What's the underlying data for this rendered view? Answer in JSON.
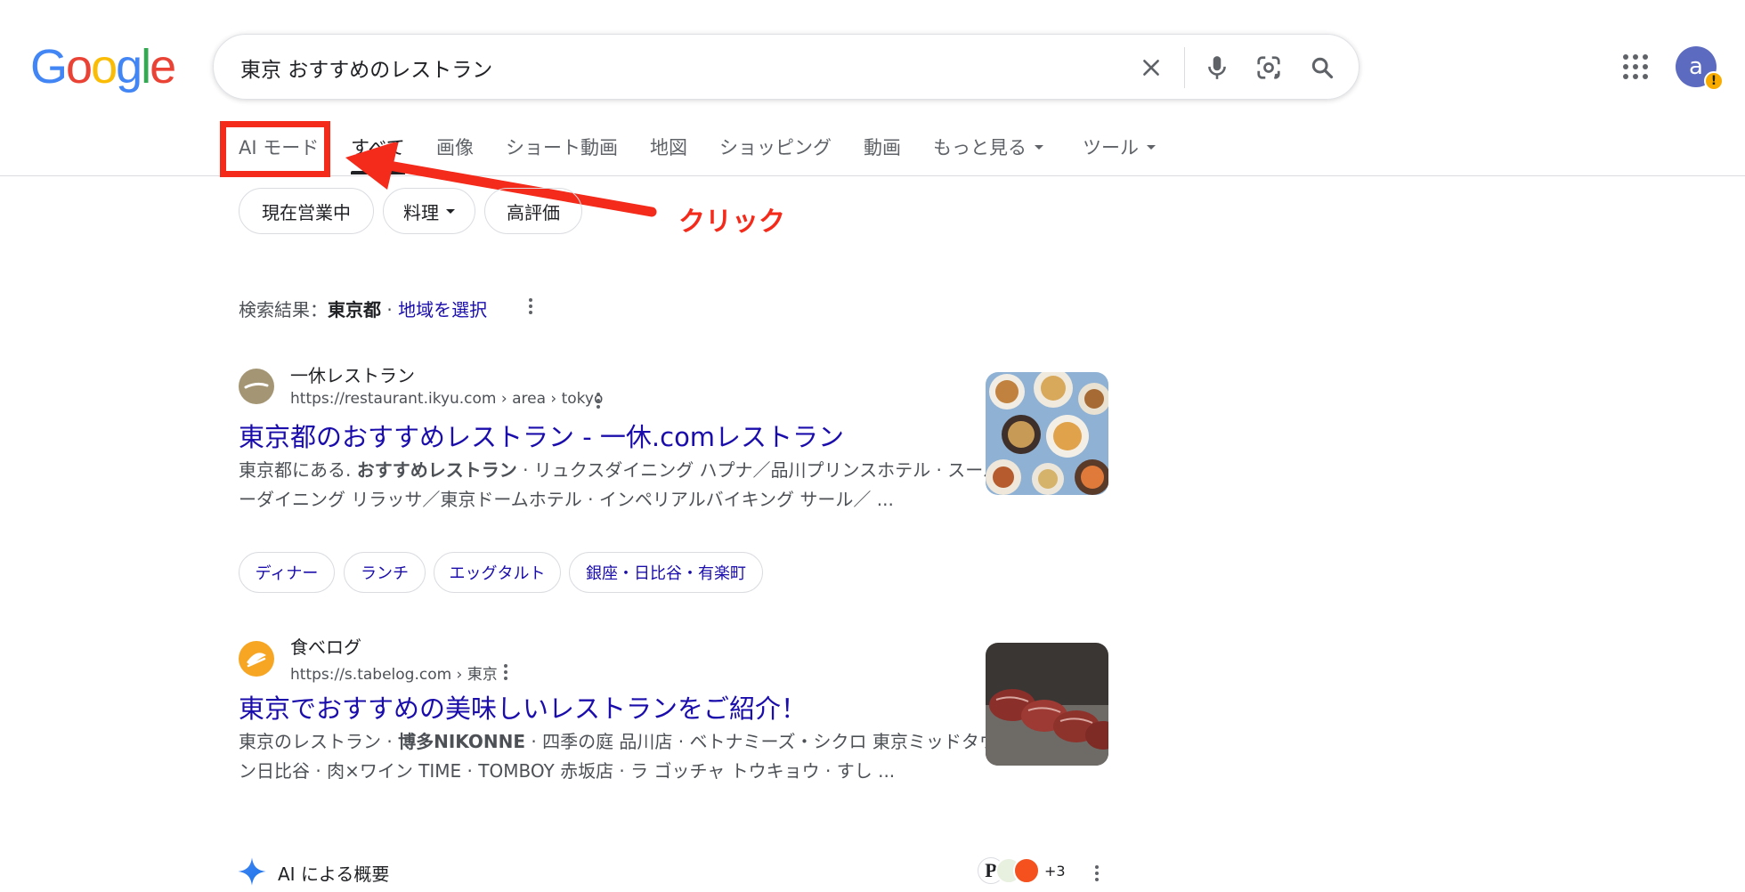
{
  "logo": {
    "letters": [
      "G",
      "o",
      "o",
      "g",
      "l",
      "e"
    ]
  },
  "search": {
    "query": "東京 おすすめのレストラン"
  },
  "account": {
    "avatar_letter": "a",
    "warning_glyph": "!"
  },
  "tabs": [
    {
      "label": "AI モード"
    },
    {
      "label": "すべて"
    },
    {
      "label": "画像"
    },
    {
      "label": "ショート動画"
    },
    {
      "label": "地図"
    },
    {
      "label": "ショッピング"
    },
    {
      "label": "動画"
    },
    {
      "label": "もっと見る"
    },
    {
      "label": "ツール"
    }
  ],
  "filters": [
    {
      "label": "現在営業中"
    },
    {
      "label": "料理"
    },
    {
      "label": "高評価"
    }
  ],
  "annotation": {
    "text": "クリック",
    "color": "#f42a1a"
  },
  "location": {
    "prefix": "検索結果：",
    "place": "東京都",
    "sep": " · ",
    "link": "地域を選択"
  },
  "results": [
    {
      "site": "一休レストラン",
      "url": "https://restaurant.ikyu.com › area › tokyo",
      "title": "東京都のおすすめレストラン - 一休.comレストラン",
      "snippet_a": "東京都にある. ",
      "snippet_bold": "おすすめレストラン",
      "snippet_b": " · リュクスダイニング ハプナ／品川プリンスホテル · スーパーダイニング リラッサ／東京ドームホテル · インペリアルバイキング サール／ ...",
      "sitelinks": [
        "ディナー",
        "ランチ",
        "エッグタルト",
        "銀座・日比谷・有楽町"
      ]
    },
    {
      "site": "食べログ",
      "url": "https://s.tabelog.com › 東京",
      "title": "東京でおすすめの美味しいレストランをご紹介！",
      "snippet_a": "東京のレストラン · ",
      "snippet_bold": "博多NIKONNE",
      "snippet_b": " · 四季の庭 品川店 · ベトナミーズ・シクロ 東京ミッドタウン日比谷 · 肉×ワイン TIME · TOMBOY 赤坂店 · ラ ゴッチャ トウキョウ · すし ..."
    }
  ],
  "ai_overview": {
    "label": "AI による概要",
    "extra_count": "+3",
    "source_p": "P"
  },
  "colors": {
    "link": "#1a0dab",
    "accent_red": "#f42a1a",
    "google_blue": "#4285f4",
    "google_red": "#ea4335",
    "google_yellow": "#fbbc05",
    "google_green": "#34a853"
  }
}
